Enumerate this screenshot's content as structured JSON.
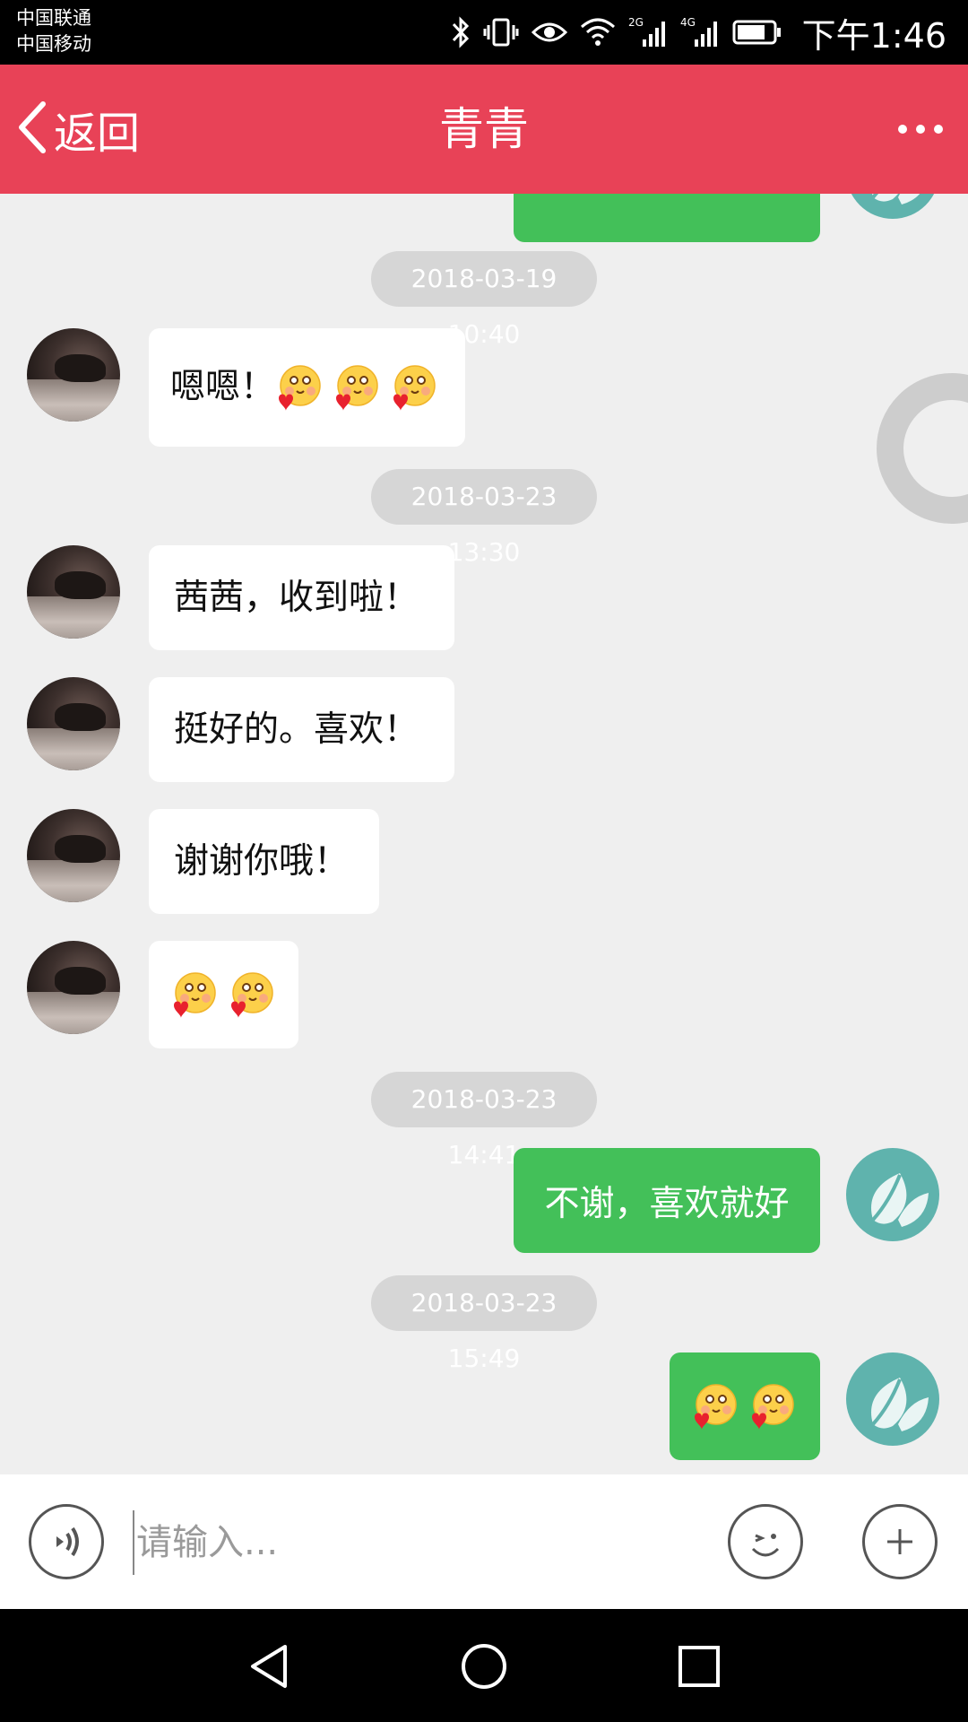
{
  "status_bar": {
    "carrier_1": "中国联通",
    "carrier_2": "中国移动",
    "net_2g": "2G",
    "net_4g": "4G",
    "time": "下午1:46"
  },
  "header": {
    "back_label": "返回",
    "title": "青青",
    "background": "#e84257"
  },
  "messages": [
    {
      "type": "timestamp",
      "text": "2018-03-19 10:40"
    },
    {
      "type": "incoming",
      "text": "嗯嗯！",
      "emojis": 3
    },
    {
      "type": "timestamp",
      "text": "2018-03-23 13:30"
    },
    {
      "type": "incoming",
      "text": "茜茜，收到啦！"
    },
    {
      "type": "incoming",
      "text": "挺好的。喜欢！"
    },
    {
      "type": "incoming",
      "text": "谢谢你哦！"
    },
    {
      "type": "incoming",
      "text": "",
      "emojis": 2
    },
    {
      "type": "timestamp",
      "text": "2018-03-23 14:41"
    },
    {
      "type": "outgoing",
      "text": "不谢，喜欢就好"
    },
    {
      "type": "timestamp",
      "text": "2018-03-23 15:49"
    },
    {
      "type": "outgoing",
      "text": "",
      "emojis": 2
    }
  ],
  "emoji_icon": "blushing-heart-emoji-icon",
  "input_bar": {
    "placeholder": "请输入..."
  },
  "colors": {
    "outgoing_bubble": "#43c059",
    "incoming_bubble": "#ffffff",
    "timestamp_pill": "#d6d6d6",
    "chat_background": "#efefef"
  }
}
